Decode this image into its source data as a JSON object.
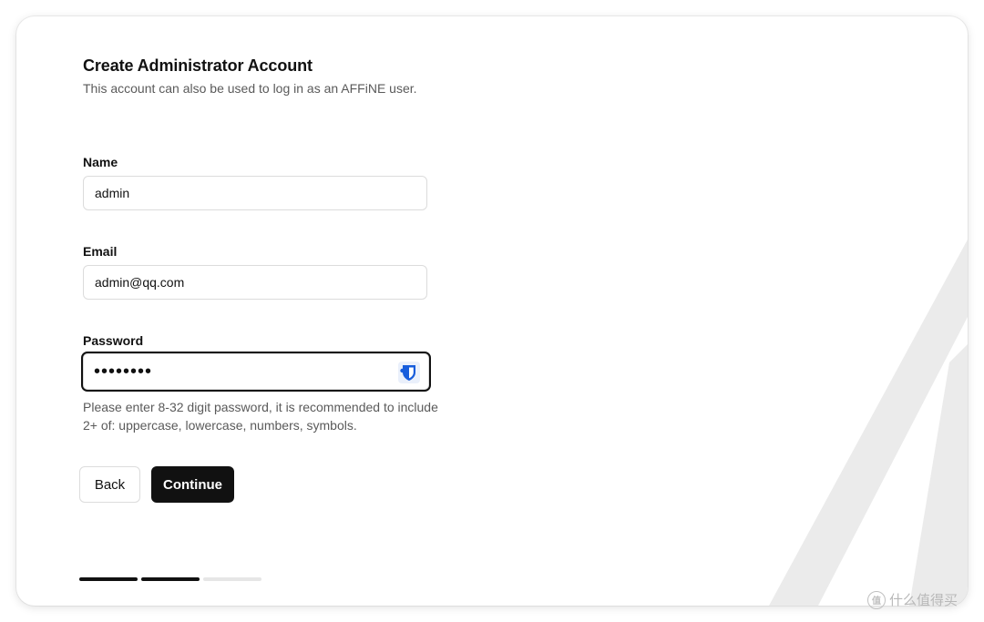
{
  "form": {
    "title": "Create Administrator Account",
    "subtitle": "This account can also be used to log in as an AFFiNE user.",
    "name": {
      "label": "Name",
      "value": "admin"
    },
    "email": {
      "label": "Email",
      "value": "admin@qq.com"
    },
    "password": {
      "label": "Password",
      "value": "password",
      "hint": "Please enter 8-32 digit password, it is recommended to include 2+ of: uppercase, lowercase, numbers, symbols.",
      "manager_icon": "bitwarden-shield-icon"
    }
  },
  "buttons": {
    "back_label": "Back",
    "continue_label": "Continue"
  },
  "progress": {
    "total_steps": 3,
    "current_step": 2
  },
  "watermark": {
    "logo_text": "值",
    "text": "什么值得买"
  },
  "colors": {
    "primary": "#111111",
    "border": "#dcdcdc",
    "muted_text": "#5a5a5a",
    "bitwarden_blue": "#175ddc"
  }
}
